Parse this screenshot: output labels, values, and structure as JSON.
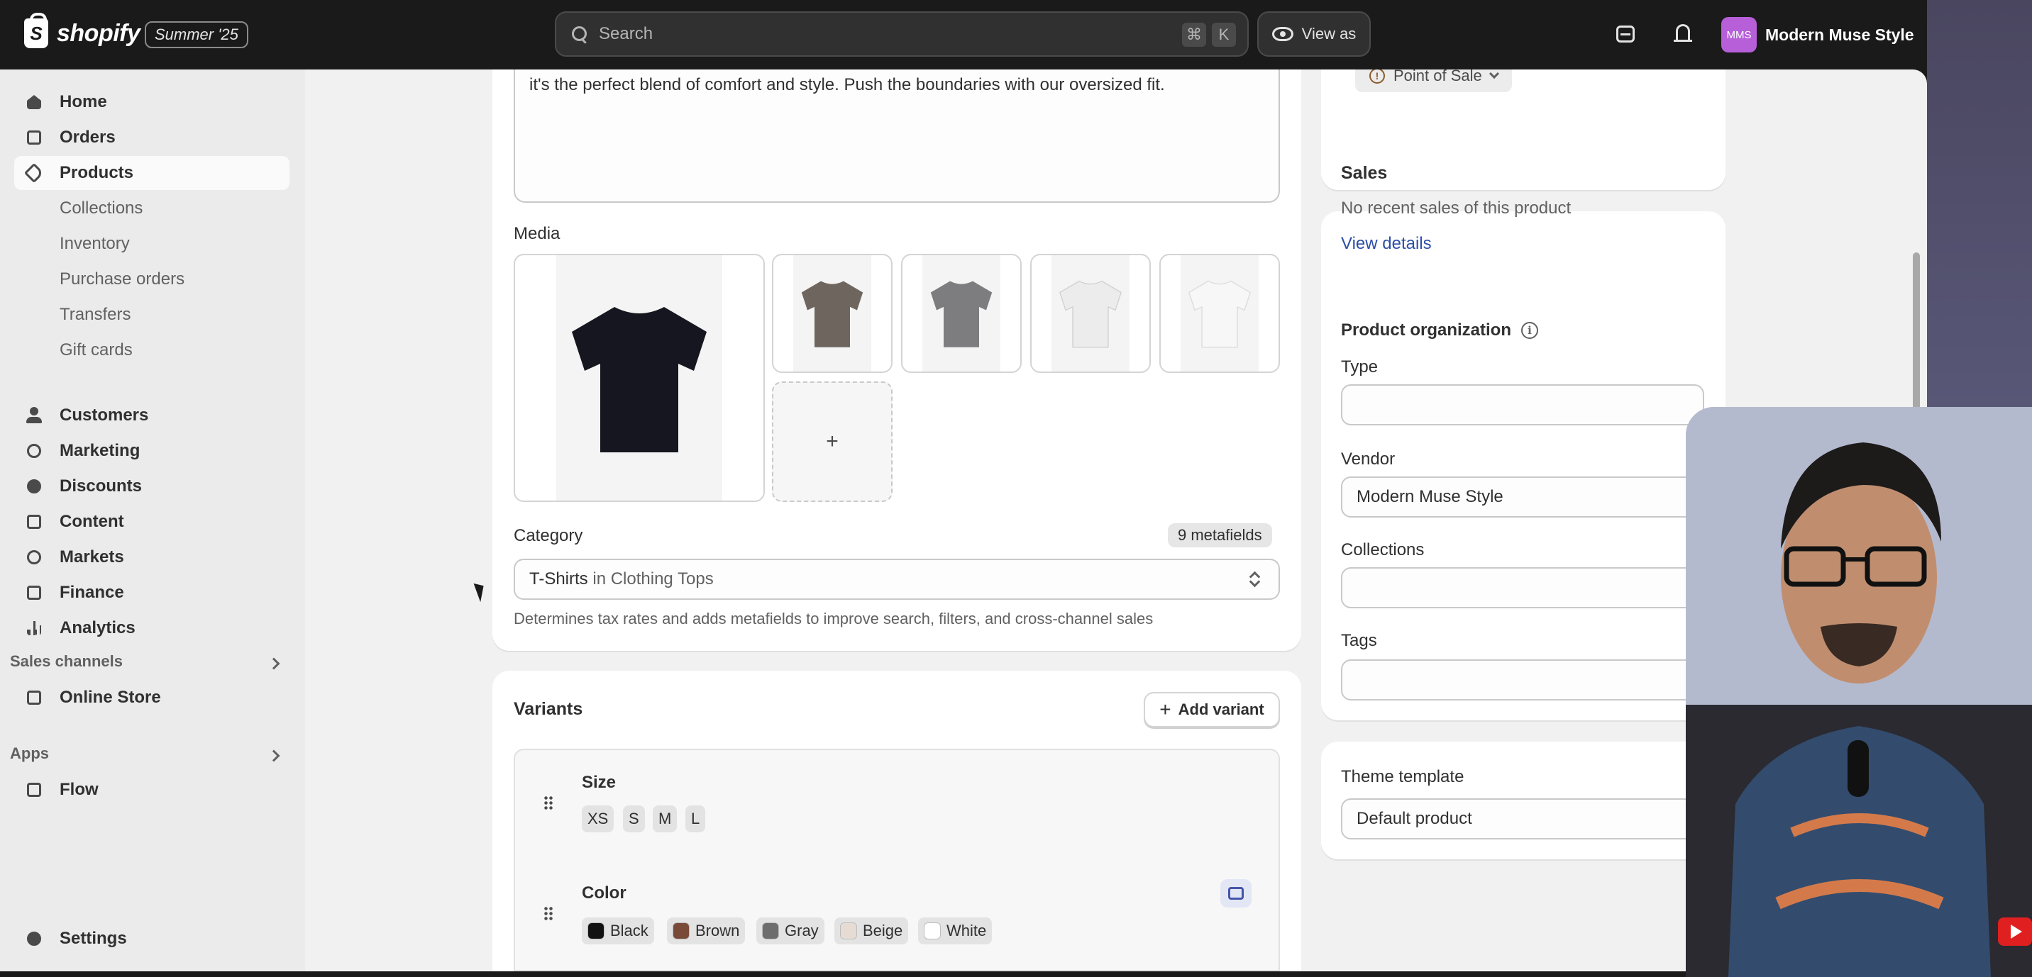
{
  "topbar": {
    "brand": "shopify",
    "edition": "Summer '25",
    "search_placeholder": "Search",
    "shortcut_keys": [
      "⌘",
      "K"
    ],
    "view_as": "View as",
    "store_initials": "MMS",
    "store_name": "Modern Muse Style"
  },
  "sidebar": {
    "items": [
      {
        "label": "Home",
        "icon": "home-icon"
      },
      {
        "label": "Orders",
        "icon": "inbox-icon"
      },
      {
        "label": "Products",
        "icon": "tag-icon"
      },
      {
        "label": "Collections"
      },
      {
        "label": "Inventory"
      },
      {
        "label": "Purchase orders"
      },
      {
        "label": "Transfers"
      },
      {
        "label": "Gift cards"
      },
      {
        "label": "Customers",
        "icon": "person-icon"
      },
      {
        "label": "Marketing",
        "icon": "target-icon"
      },
      {
        "label": "Discounts",
        "icon": "discount-icon"
      },
      {
        "label": "Content",
        "icon": "content-icon"
      },
      {
        "label": "Markets",
        "icon": "globe-icon"
      },
      {
        "label": "Finance",
        "icon": "bank-icon"
      },
      {
        "label": "Analytics",
        "icon": "bar-chart-icon"
      }
    ],
    "sales_channels_label": "Sales channels",
    "online_store": "Online Store",
    "apps_label": "Apps",
    "flow": "Flow",
    "settings": "Settings"
  },
  "product": {
    "description_text": "it's the perfect blend of comfort and style. Push the boundaries with our oversized fit.",
    "media_label": "Media",
    "media_colors": [
      "#15161f",
      "#6e665e",
      "#7d7d7f",
      "#eeeeee",
      "#f4f4f4"
    ],
    "category_label": "Category",
    "metafields_badge": "9 metafields",
    "category_value_strong": "T-Shirts",
    "category_value_rest": " in Clothing Tops",
    "category_hint": "Determines tax rates and adds metafields to improve search, filters, and cross-channel sales"
  },
  "variants": {
    "title": "Variants",
    "add_variant": "Add variant",
    "size_label": "Size",
    "sizes": [
      "XS",
      "S",
      "M",
      "L"
    ],
    "color_label": "Color",
    "colors": [
      {
        "name": "Black",
        "hex": "#111111"
      },
      {
        "name": "Brown",
        "hex": "#7a4a38"
      },
      {
        "name": "Gray",
        "hex": "#6d6d6d"
      },
      {
        "name": "Beige",
        "hex": "#e6dcd4"
      },
      {
        "name": "White",
        "hex": "#ffffff"
      }
    ]
  },
  "right": {
    "pos_badge": "Point of Sale",
    "sales_title": "Sales",
    "sales_text": "No recent sales of this product",
    "view_details": "View details",
    "org_title": "Product organization",
    "type_label": "Type",
    "type_value": "",
    "vendor_label": "Vendor",
    "vendor_value": "Modern Muse Style",
    "collections_label": "Collections",
    "collections_value": "",
    "tags_label": "Tags",
    "tags_value": "",
    "theme_label": "Theme template",
    "theme_value": "Default product"
  },
  "colors": {
    "topbar_bg": "#1a1a1a",
    "page_bg": "#f1f1f1",
    "link": "#2c4ea8",
    "avatar": "#b65fd8"
  }
}
